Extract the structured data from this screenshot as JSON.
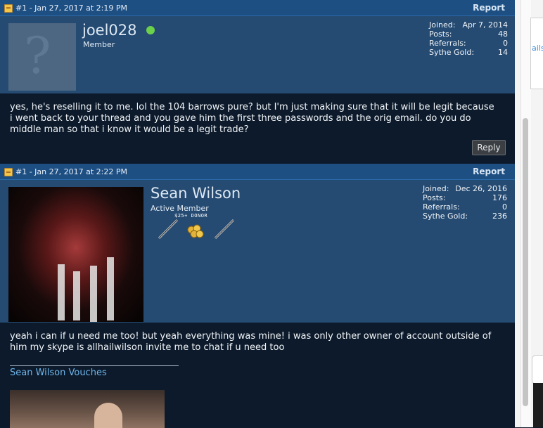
{
  "posts": [
    {
      "header": {
        "date": "#1 - Jan 27, 2017 at 2:19 PM",
        "report": "Report"
      },
      "user": {
        "name": "joel028",
        "title": "Member"
      },
      "stats": [
        {
          "label": "Joined:",
          "value": "Apr 7, 2014"
        },
        {
          "label": "Posts:",
          "value": "48"
        },
        {
          "label": "Referrals:",
          "value": "0"
        },
        {
          "label": "Sythe Gold:",
          "value": "14"
        }
      ],
      "message": [
        "yes, he's reselling it to me. lol the 104 barrows pure? but I'm just making sure that it will be legit because",
        "i went back to your thread and you gave him the first three passwords and the orig email. do you do",
        "middle man so that i know it would be a legit trade?"
      ],
      "reply": "Reply"
    },
    {
      "header": {
        "date": "#1 - Jan 27, 2017 at 2:22 PM",
        "report": "Report"
      },
      "user": {
        "name": "Sean Wilson",
        "title": "Active Member",
        "badge_text": "$25+ DONOR"
      },
      "stats": [
        {
          "label": "Joined:",
          "value": "Dec 26, 2016"
        },
        {
          "label": "Posts:",
          "value": "176"
        },
        {
          "label": "Referrals:",
          "value": "0"
        },
        {
          "label": "Sythe Gold:",
          "value": "236"
        }
      ],
      "message": [
        "yeah i can if u need me too! but yeah everything was mine! i was only other owner of account outside of",
        "him my skype is allhailwilson invite me to chat if u need too"
      ],
      "signature_link": "Sean Wilson Vouches"
    }
  ],
  "right_panel": {
    "cut_text": "ails"
  },
  "colors": {
    "online": "#6bd14a",
    "link": "#6fb6ea",
    "header_bg": "#1e4f83"
  }
}
